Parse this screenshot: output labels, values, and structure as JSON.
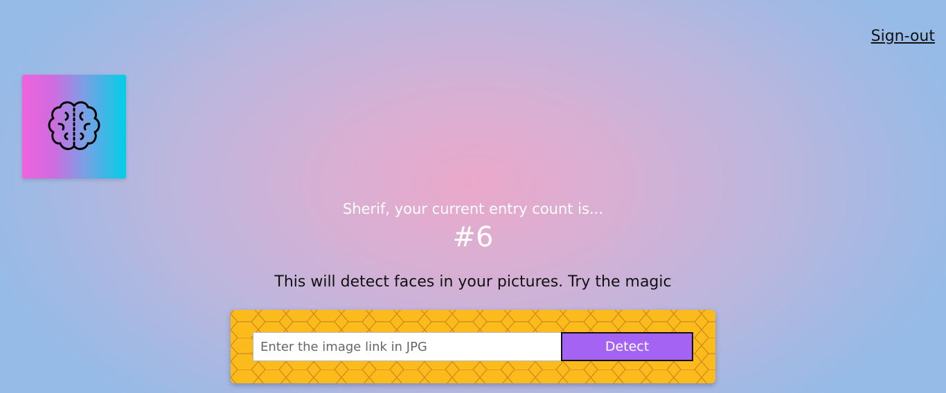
{
  "header": {
    "signout_label": "Sign-out"
  },
  "logo": {
    "icon": "brain-icon",
    "gradient": [
      "#ef62dd",
      "#00cfe6"
    ]
  },
  "rank": {
    "message": "Sherif, your current entry count is...",
    "count": "#6"
  },
  "main": {
    "tagline": "This will detect faces in your pictures. Try the magic"
  },
  "form": {
    "input_value": "",
    "input_placeholder": "Enter the image link in JPG",
    "detect_label": "Detect",
    "panel_color": "#fcbb1c",
    "button_color": "#a463f2"
  }
}
